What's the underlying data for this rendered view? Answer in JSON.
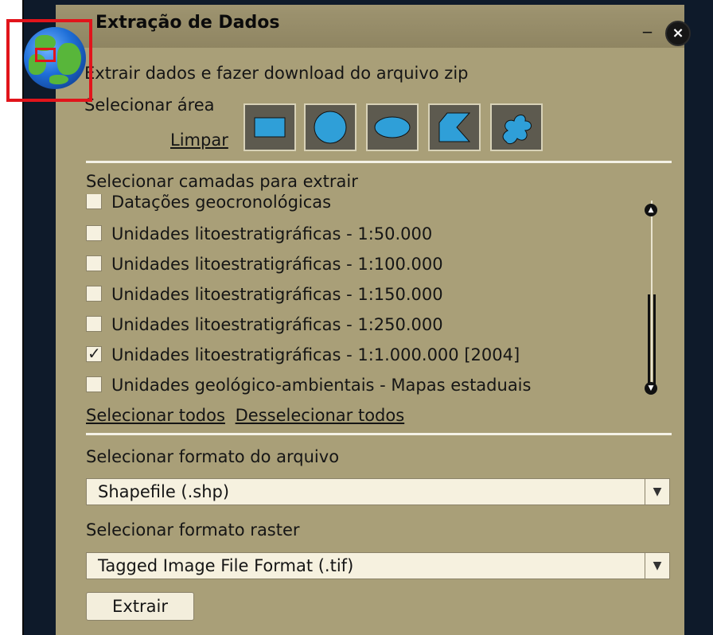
{
  "window": {
    "title": "Extração de Dados",
    "minimize_label": "_",
    "close_label": "×"
  },
  "description": "Extrair dados e fazer download do arquivo zip",
  "area": {
    "label": "Selecionar área",
    "clear_label": "Limpar",
    "tools": [
      "rectangle-icon",
      "circle-icon",
      "ellipse-icon",
      "polygon-icon",
      "freehand-icon"
    ]
  },
  "layers": {
    "heading": "Selecionar camadas para extrair",
    "items": [
      {
        "label": "Datações geocronológicas",
        "checked": false
      },
      {
        "label": "Unidades litoestratigráficas - 1:50.000",
        "checked": false
      },
      {
        "label": "Unidades litoestratigráficas - 1:100.000",
        "checked": false
      },
      {
        "label": "Unidades litoestratigráficas - 1:150.000",
        "checked": false
      },
      {
        "label": "Unidades litoestratigráficas - 1:250.000",
        "checked": false
      },
      {
        "label": "Unidades litoestratigráficas - 1:1.000.000 [2004]",
        "checked": true
      },
      {
        "label": "Unidades geológico-ambientais - Mapas estaduais",
        "checked": false
      }
    ],
    "select_all": "Selecionar todos",
    "deselect_all": "Desselecionar todos"
  },
  "file_format": {
    "label": "Selecionar formato do arquivo",
    "value": "Shapefile (.shp)"
  },
  "raster_format": {
    "label": "Selecionar formato raster",
    "value": "Tagged Image File Format (.tif)"
  },
  "extract_button": "Extrair",
  "colors": {
    "panel": "#a99f78",
    "frame": "#0e1a2a",
    "tool_fill": "#2f9fd8",
    "highlight": "#e1141b"
  }
}
